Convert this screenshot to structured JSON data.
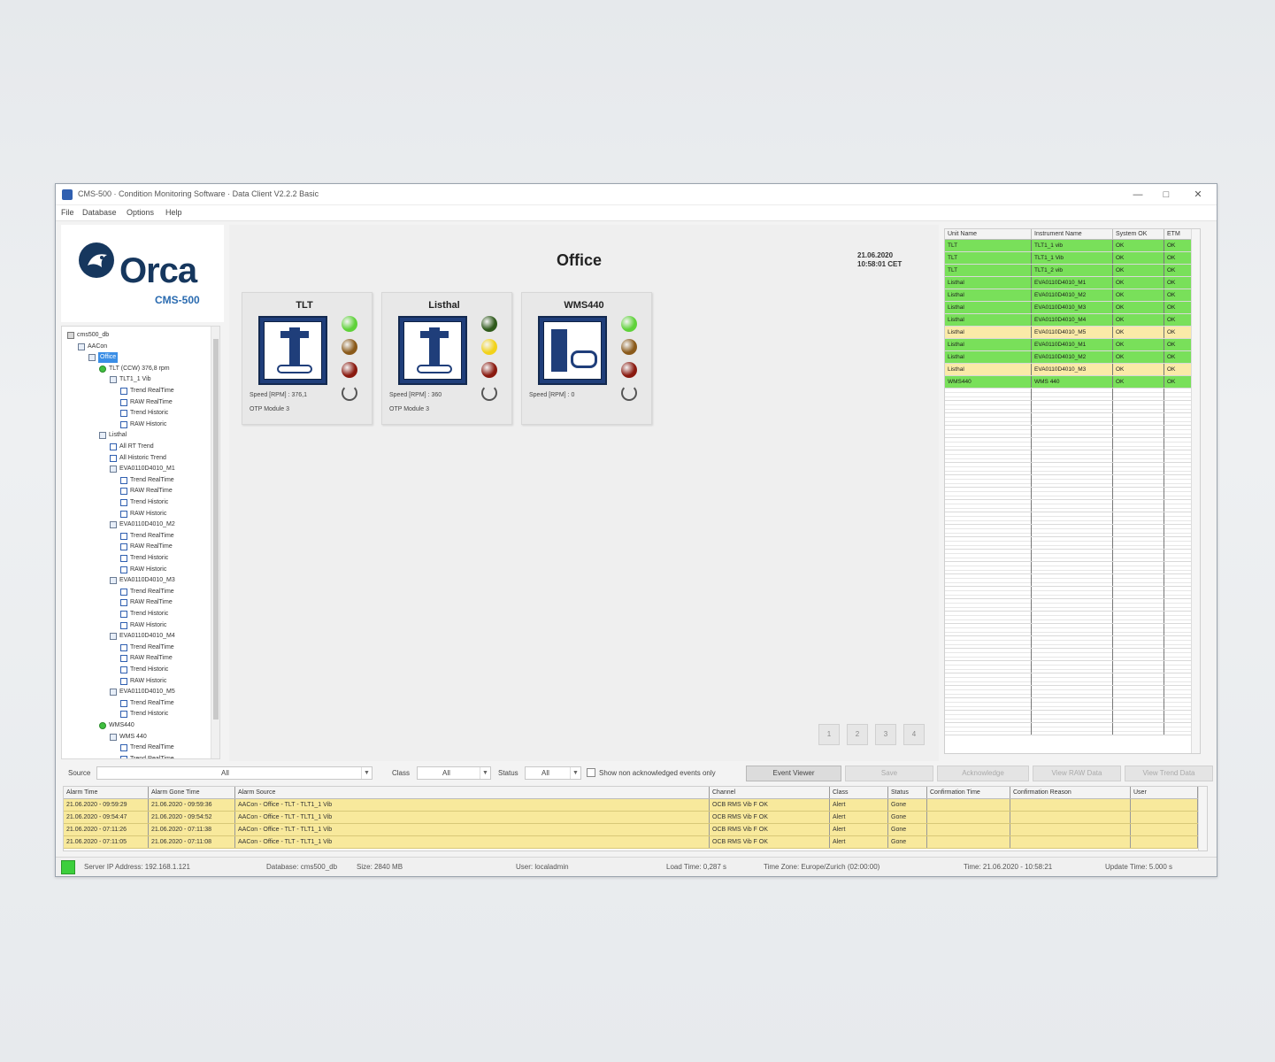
{
  "window": {
    "title": "CMS-500 · Condition Monitoring Software · Data Client V2.2.2 Basic",
    "controls": [
      "—",
      "□",
      "✕"
    ]
  },
  "menu": [
    "File",
    "Database",
    "Options",
    "Help"
  ],
  "logo": {
    "word": "Orca",
    "sub": "CMS-500"
  },
  "tree": [
    {
      "label": "cms500_db",
      "icon": "db",
      "indent": 0
    },
    {
      "label": "AACon",
      "icon": "box",
      "indent": 1
    },
    {
      "label": "Office",
      "icon": "box",
      "indent": 2,
      "selected": true
    },
    {
      "label": "TLT (CCW) 376,8 rpm",
      "icon": "green",
      "indent": 3
    },
    {
      "label": "TLT1_1 Vib",
      "icon": "box",
      "indent": 4
    },
    {
      "label": "Trend RealTime",
      "icon": "chart",
      "indent": 5
    },
    {
      "label": "RAW RealTime",
      "icon": "chart",
      "indent": 5
    },
    {
      "label": "Trend Historic",
      "icon": "chart",
      "indent": 5
    },
    {
      "label": "RAW Historic",
      "icon": "chart",
      "indent": 5
    },
    {
      "label": "Listhal",
      "icon": "box",
      "indent": 3
    },
    {
      "label": "All RT Trend",
      "icon": "chart",
      "indent": 4
    },
    {
      "label": "All Historic Trend",
      "icon": "chart",
      "indent": 4
    },
    {
      "label": "EVA0110D4010_M1",
      "icon": "box",
      "indent": 4
    },
    {
      "label": "Trend RealTime",
      "icon": "chart",
      "indent": 5
    },
    {
      "label": "RAW RealTime",
      "icon": "chart",
      "indent": 5
    },
    {
      "label": "Trend Historic",
      "icon": "chart",
      "indent": 5
    },
    {
      "label": "RAW Historic",
      "icon": "chart",
      "indent": 5
    },
    {
      "label": "EVA0110D4010_M2",
      "icon": "box",
      "indent": 4
    },
    {
      "label": "Trend RealTime",
      "icon": "chart",
      "indent": 5
    },
    {
      "label": "RAW RealTime",
      "icon": "chart",
      "indent": 5
    },
    {
      "label": "Trend Historic",
      "icon": "chart",
      "indent": 5
    },
    {
      "label": "RAW Historic",
      "icon": "chart",
      "indent": 5
    },
    {
      "label": "EVA0110D4010_M3",
      "icon": "box",
      "indent": 4
    },
    {
      "label": "Trend RealTime",
      "icon": "chart",
      "indent": 5
    },
    {
      "label": "RAW RealTime",
      "icon": "chart",
      "indent": 5
    },
    {
      "label": "Trend Historic",
      "icon": "chart",
      "indent": 5
    },
    {
      "label": "RAW Historic",
      "icon": "chart",
      "indent": 5
    },
    {
      "label": "EVA0110D4010_M4",
      "icon": "box",
      "indent": 4
    },
    {
      "label": "Trend RealTime",
      "icon": "chart",
      "indent": 5
    },
    {
      "label": "RAW RealTime",
      "icon": "chart",
      "indent": 5
    },
    {
      "label": "Trend Historic",
      "icon": "chart",
      "indent": 5
    },
    {
      "label": "RAW Historic",
      "icon": "chart",
      "indent": 5
    },
    {
      "label": "EVA0110D4010_M5",
      "icon": "box",
      "indent": 4
    },
    {
      "label": "Trend RealTime",
      "icon": "chart",
      "indent": 5
    },
    {
      "label": "Trend Historic",
      "icon": "chart",
      "indent": 5
    },
    {
      "label": "WMS440",
      "icon": "green",
      "indent": 3
    },
    {
      "label": "WMS 440",
      "icon": "box",
      "indent": 4
    },
    {
      "label": "Trend RealTime",
      "icon": "chart",
      "indent": 5
    },
    {
      "label": "Trend RealTime",
      "icon": "chart",
      "indent": 5
    }
  ],
  "main": {
    "title": "Office",
    "date": "21.06.2020",
    "time": "10:58:01 CET",
    "tiles": [
      {
        "name": "TLT",
        "kind": "pump",
        "leds": [
          "#5fd23a",
          "#8a5a1a",
          "#8a1a10"
        ],
        "speed": "Speed [RPM] : 376,1",
        "extra": "OTP Module 3"
      },
      {
        "name": "Listhal",
        "kind": "pump",
        "leds": [
          "#2f5a1c",
          "#f2d21a",
          "#8a1a10"
        ],
        "speed": "Speed [RPM] : 360",
        "extra": "OTP Module 3"
      },
      {
        "name": "WMS440",
        "kind": "motor",
        "leds": [
          "#5fd23a",
          "#8a5a1a",
          "#8a1a10"
        ],
        "speed": "Speed [RPM] : 0",
        "extra": ""
      }
    ],
    "pager": [
      "1",
      "2",
      "3",
      "4"
    ]
  },
  "status_table": {
    "headers": [
      "Unit Name",
      "Instrument Name",
      "System OK",
      "ETM"
    ],
    "rows": [
      {
        "c": [
          "TLT",
          "TLT1_1 vib",
          "OK",
          "OK"
        ],
        "s": "ok"
      },
      {
        "c": [
          "TLT",
          "TLT1_1 Vib",
          "OK",
          "OK"
        ],
        "s": "ok"
      },
      {
        "c": [
          "TLT",
          "TLT1_2 vib",
          "OK",
          "OK"
        ],
        "s": "ok"
      },
      {
        "c": [
          "Listhal",
          "EVA0110D4010_M1",
          "OK",
          "OK"
        ],
        "s": "ok"
      },
      {
        "c": [
          "Listhal",
          "EVA0110D4010_M2",
          "OK",
          "OK"
        ],
        "s": "ok"
      },
      {
        "c": [
          "Listhal",
          "EVA0110D4010_M3",
          "OK",
          "OK"
        ],
        "s": "ok"
      },
      {
        "c": [
          "Listhal",
          "EVA0110D4010_M4",
          "OK",
          "OK"
        ],
        "s": "ok"
      },
      {
        "c": [
          "Listhal",
          "EVA0110D4010_M5",
          "OK",
          "OK"
        ],
        "s": "warn"
      },
      {
        "c": [
          "Listhal",
          "EVA0110D4010_M1",
          "OK",
          "OK"
        ],
        "s": "ok"
      },
      {
        "c": [
          "Listhal",
          "EVA0110D4010_M2",
          "OK",
          "OK"
        ],
        "s": "ok"
      },
      {
        "c": [
          "Listhal",
          "EVA0110D4010_M3",
          "OK",
          "OK"
        ],
        "s": "warn"
      },
      {
        "c": [
          "WMS440",
          "WMS 440",
          "OK",
          "OK"
        ],
        "s": "ok"
      }
    ]
  },
  "filter": {
    "source_label": "Source",
    "source_value": "All",
    "class_label": "Class",
    "class_value": "All",
    "status_label": "Status",
    "status_value": "All",
    "checkbox_label": "Show non acknowledged events only",
    "buttons": [
      "Event Viewer",
      "Save",
      "Acknowledge",
      "View RAW Data",
      "View Trend Data"
    ]
  },
  "alarms": {
    "headers": [
      "Alarm Time",
      "Alarm Gone Time",
      "Alarm Source",
      "Channel",
      "Class",
      "Status",
      "Confirmation Time",
      "Confirmation Reason",
      "User"
    ],
    "rows": [
      [
        "21.06.2020 - 09:59:29",
        "21.06.2020 - 09:59:36",
        "AACon - Office - TLT - TLT1_1 Vib",
        "OCB RMS Vib F OK",
        "Alert",
        "Gone",
        "",
        "",
        ""
      ],
      [
        "21.06.2020 - 09:54:47",
        "21.06.2020 - 09:54:52",
        "AACon - Office - TLT - TLT1_1 Vib",
        "OCB RMS Vib F OK",
        "Alert",
        "Gone",
        "",
        "",
        ""
      ],
      [
        "21.06.2020 - 07:11:26",
        "21.06.2020 - 07:11:38",
        "AACon - Office - TLT - TLT1_1 Vib",
        "OCB RMS Vib F OK",
        "Alert",
        "Gone",
        "",
        "",
        ""
      ],
      [
        "21.06.2020 - 07:11:05",
        "21.06.2020 - 07:11:08",
        "AACon - Office - TLT - TLT1_1 Vib",
        "OCB RMS Vib F OK",
        "Alert",
        "Gone",
        "",
        "",
        ""
      ]
    ]
  },
  "statusbar": {
    "server": "Server IP Address: 192.168.1.121",
    "database": "Database: cms500_db",
    "size": "Size: 2840 MB",
    "user": "User: localadmin",
    "load": "Load Time: 0,287 s",
    "timezone": "Time Zone: Europe/Zurich (02:00:00)",
    "time": "Time: 21.06.2020 - 10:58:21",
    "update": "Update Time: 5.000 s"
  }
}
